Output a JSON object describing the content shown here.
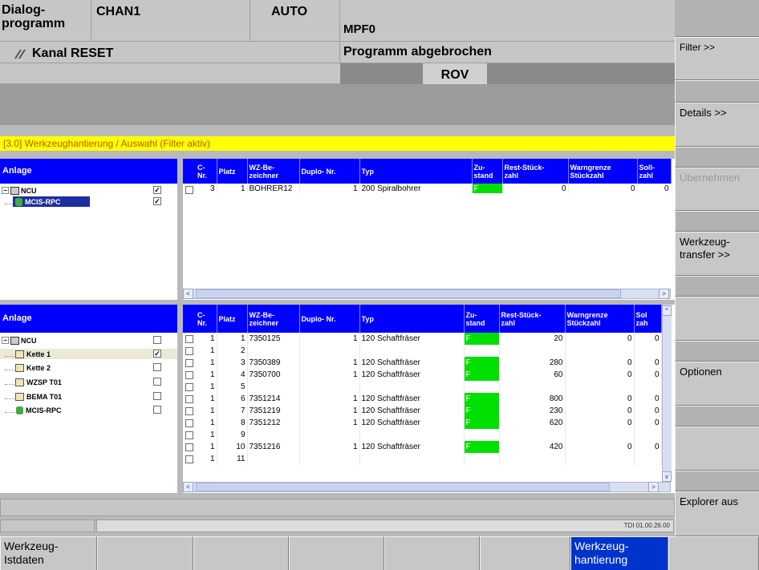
{
  "header": {
    "dialog": "Dialog-\nprogramm",
    "channel": "CHAN1",
    "mode": "AUTO",
    "program": "MPF0",
    "channel_state": "Kanal RESET",
    "program_state": "Programm abgebrochen",
    "rov": "ROV",
    "title": "[3.0] Werkzeughantierung / Auswahl (Filter aktiv)"
  },
  "side_softkeys": [
    "Filter >>",
    "Details >>",
    "Übernehmen",
    "Werkzeug-\ntransfer >>",
    "",
    "Optionen",
    "",
    "Explorer aus"
  ],
  "bottom_softkeys": [
    "Werkzeug-\nIstdaten",
    "",
    "",
    "",
    "",
    "",
    "Werkzeug-\nhantierung",
    ""
  ],
  "colors": {
    "header_blue": "#0000ff",
    "title_yellow": "#ffff00",
    "status_green": "#00e000",
    "active_softkey": "#0033cc"
  },
  "upper": {
    "tree_header": "Anlage",
    "tree": [
      {
        "label": "NCU",
        "icon": "ncu-icon",
        "checked": true
      },
      {
        "label": "MCIS-RPC",
        "icon": "database-icon",
        "checked": true,
        "selected": true
      }
    ],
    "columns": [
      "C-\nNr.",
      "Platz",
      "WZ-Be-\nzeichner",
      "Duplo- Nr.",
      "Typ",
      "Zu-\nstand",
      "Rest-Stück-\nzahl",
      "Warngrenze\nStückzahl",
      "Soll-\nzahl"
    ],
    "rows": [
      {
        "c": "3",
        "platz": "1",
        "wz": "BOHRER12",
        "duplo": "1",
        "typ": "200 Spiralbohrer",
        "zu": "F",
        "rest": "0",
        "warn": "0",
        "soll": "0"
      }
    ]
  },
  "lower": {
    "tree_header": "Anlage",
    "tree": [
      {
        "label": "NCU",
        "icon": "ncu-icon",
        "checked": false
      },
      {
        "label": "Kette 1",
        "icon": "chain-icon",
        "checked": true,
        "highlight": true
      },
      {
        "label": "Kette 2",
        "icon": "chain-icon",
        "checked": false
      },
      {
        "label": "WZSP T01",
        "icon": "chain-icon",
        "checked": false
      },
      {
        "label": "BEMA T01",
        "icon": "chain-icon",
        "checked": false
      },
      {
        "label": "MCIS-RPC",
        "icon": "database-icon",
        "checked": false
      }
    ],
    "columns": [
      "C-\nNr.",
      "Platz",
      "WZ-Be-\nzeichner",
      "Duplo- Nr.",
      "Typ",
      "Zu-\nstand",
      "Rest-Stück-\nzahl",
      "Warngrenze\nStückzahl",
      "Sol\nzah"
    ],
    "rows": [
      {
        "c": "1",
        "platz": "1",
        "wz": "7350125",
        "duplo": "1",
        "typ": "120 Schaftfräser",
        "zu": "F",
        "rest": "20",
        "warn": "0",
        "soll": "0"
      },
      {
        "c": "1",
        "platz": "2",
        "wz": "",
        "duplo": "",
        "typ": "",
        "zu": "",
        "rest": "",
        "warn": "",
        "soll": ""
      },
      {
        "c": "1",
        "platz": "3",
        "wz": "7350389",
        "duplo": "1",
        "typ": "120 Schaftfräser",
        "zu": "F",
        "rest": "280",
        "warn": "0",
        "soll": "0"
      },
      {
        "c": "1",
        "platz": "4",
        "wz": "7350700",
        "duplo": "1",
        "typ": "120 Schaftfräser",
        "zu": "F",
        "rest": "60",
        "warn": "0",
        "soll": "0"
      },
      {
        "c": "1",
        "platz": "5",
        "wz": "",
        "duplo": "",
        "typ": "",
        "zu": "",
        "rest": "",
        "warn": "",
        "soll": ""
      },
      {
        "c": "1",
        "platz": "6",
        "wz": "7351214",
        "duplo": "1",
        "typ": "120 Schaftfräser",
        "zu": "F",
        "rest": "800",
        "warn": "0",
        "soll": "0"
      },
      {
        "c": "1",
        "platz": "7",
        "wz": "7351219",
        "duplo": "1",
        "typ": "120 Schaftfräser",
        "zu": "F",
        "rest": "230",
        "warn": "0",
        "soll": "0"
      },
      {
        "c": "1",
        "platz": "8",
        "wz": "7351212",
        "duplo": "1",
        "typ": "120 Schaftfräser",
        "zu": "F",
        "rest": "620",
        "warn": "0",
        "soll": "0"
      },
      {
        "c": "1",
        "platz": "9",
        "wz": "",
        "duplo": "",
        "typ": "",
        "zu": "",
        "rest": "",
        "warn": "",
        "soll": ""
      },
      {
        "c": "1",
        "platz": "10",
        "wz": "7351216",
        "duplo": "1",
        "typ": "120 Schaftfräser",
        "zu": "F",
        "rest": "420",
        "warn": "0",
        "soll": "0"
      },
      {
        "c": "1",
        "platz": "11",
        "wz": "",
        "duplo": "",
        "typ": "",
        "zu": "",
        "rest": "",
        "warn": "",
        "soll": ""
      }
    ]
  },
  "status_version": "TDI 01.00.26.00"
}
